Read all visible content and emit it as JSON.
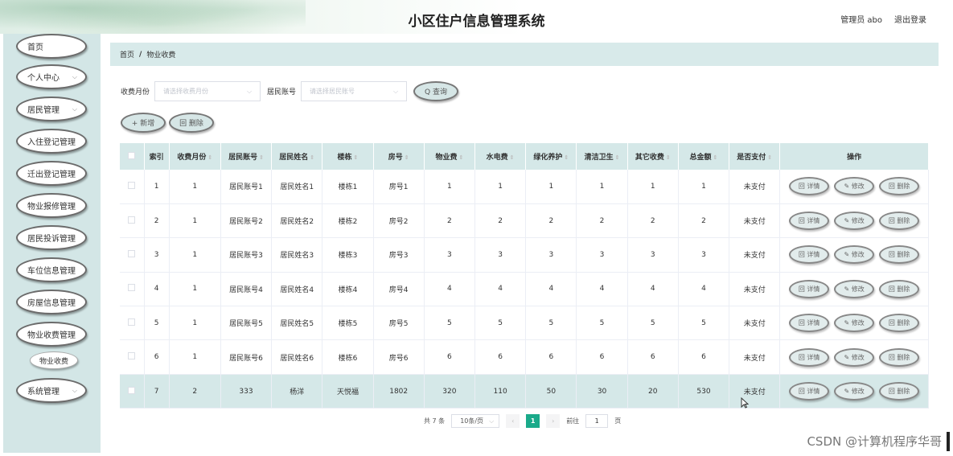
{
  "header": {
    "title": "小区住户信息管理系统",
    "user": "管理员 abo",
    "logout": "退出登录"
  },
  "sidebar": {
    "items": [
      {
        "label": "首页",
        "chevron": false
      },
      {
        "label": "个人中心",
        "chevron": true
      },
      {
        "label": "居民管理",
        "chevron": true
      },
      {
        "label": "入住登记管理",
        "chevron": false
      },
      {
        "label": "迁出登记管理",
        "chevron": false
      },
      {
        "label": "物业报修管理",
        "chevron": false
      },
      {
        "label": "居民投诉管理",
        "chevron": false
      },
      {
        "label": "车位信息管理",
        "chevron": false
      },
      {
        "label": "房屋信息管理",
        "chevron": false
      },
      {
        "label": "物业收费管理",
        "chevron": false
      },
      {
        "label": "系统管理",
        "chevron": true
      }
    ],
    "sub_item": "物业收费"
  },
  "breadcrumb": {
    "home": "首页",
    "sep": "/",
    "current": "物业收费"
  },
  "search": {
    "month_label": "收费月份",
    "month_placeholder": "请选择收费月份",
    "account_label": "居民账号",
    "account_placeholder": "请选择居民账号",
    "query": "Q 查询"
  },
  "actions": {
    "add": "+ 新增",
    "delete": "回 删除"
  },
  "table": {
    "headers": [
      "索引",
      "收费月份",
      "居民账号",
      "居民姓名",
      "楼栋",
      "房号",
      "物业费",
      "水电费",
      "绿化养护",
      "清洁卫生",
      "其它收费",
      "总金额",
      "是否支付",
      "操作"
    ],
    "rows": [
      [
        "1",
        "1",
        "居民账号1",
        "居民姓名1",
        "楼栋1",
        "房号1",
        "1",
        "1",
        "1",
        "1",
        "1",
        "1",
        "未支付"
      ],
      [
        "2",
        "1",
        "居民账号2",
        "居民姓名2",
        "楼栋2",
        "房号2",
        "2",
        "2",
        "2",
        "2",
        "2",
        "2",
        "未支付"
      ],
      [
        "3",
        "1",
        "居民账号3",
        "居民姓名3",
        "楼栋3",
        "房号3",
        "3",
        "3",
        "3",
        "3",
        "3",
        "3",
        "未支付"
      ],
      [
        "4",
        "1",
        "居民账号4",
        "居民姓名4",
        "楼栋4",
        "房号4",
        "4",
        "4",
        "4",
        "4",
        "4",
        "4",
        "未支付"
      ],
      [
        "5",
        "1",
        "居民账号5",
        "居民姓名5",
        "楼栋5",
        "房号5",
        "5",
        "5",
        "5",
        "5",
        "5",
        "5",
        "未支付"
      ],
      [
        "6",
        "1",
        "居民账号6",
        "居民姓名6",
        "楼栋6",
        "房号6",
        "6",
        "6",
        "6",
        "6",
        "6",
        "6",
        "未支付"
      ],
      [
        "7",
        "2",
        "333",
        "杨洋",
        "天悦福",
        "1802",
        "320",
        "110",
        "50",
        "30",
        "20",
        "530",
        "未支付"
      ]
    ],
    "row_ops": {
      "detail": "回 详情",
      "edit": "✎ 修改",
      "delete": "回 删除"
    }
  },
  "pagination": {
    "total": "共 7 条",
    "page_size": "10条/页",
    "prev": "‹",
    "current": "1",
    "next": "›",
    "goto_label": "前往",
    "goto_value": "1",
    "page_unit": "页"
  },
  "watermark": "CSDN @计算机程序华哥",
  "colors": {
    "accent": "#1aaa8a",
    "panel": "#d5e8e8",
    "sidebar": "#d3e6e6"
  }
}
